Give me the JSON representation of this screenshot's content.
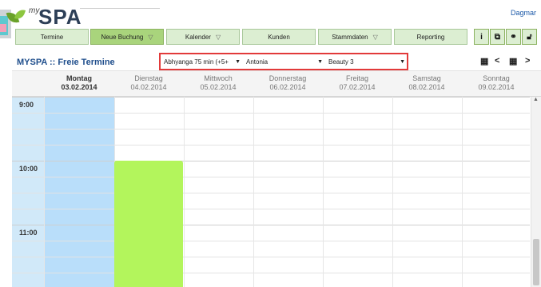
{
  "brand": {
    "prefix": "my",
    "name": "SPA"
  },
  "user": "Dagmar",
  "nav": [
    {
      "label": "Termine",
      "dropdown": false,
      "active": false
    },
    {
      "label": "Neue Buchung",
      "dropdown": true,
      "active": true
    },
    {
      "label": "Kalender",
      "dropdown": true,
      "active": false
    },
    {
      "label": "Kunden",
      "dropdown": false,
      "active": false
    },
    {
      "label": "Stammdaten",
      "dropdown": true,
      "active": false
    },
    {
      "label": "Reporting",
      "dropdown": false,
      "active": false
    }
  ],
  "toolbar_icons": [
    "info-icon",
    "copy-icon",
    "users-icon",
    "lock-icon"
  ],
  "page_title": "MYSPA :: Freie Termine",
  "filters": {
    "treatment": "Abhyanga 75 min (+5+",
    "staff": "Antonia",
    "room": "Beauty 3"
  },
  "days": [
    {
      "name": "Montag",
      "date": "03.02.2014",
      "today": true
    },
    {
      "name": "Dienstag",
      "date": "04.02.2014",
      "today": false
    },
    {
      "name": "Mittwoch",
      "date": "05.02.2014",
      "today": false
    },
    {
      "name": "Donnerstag",
      "date": "06.02.2014",
      "today": false
    },
    {
      "name": "Freitag",
      "date": "07.02.2014",
      "today": false
    },
    {
      "name": "Samstag",
      "date": "08.02.2014",
      "today": false
    },
    {
      "name": "Sonntag",
      "date": "09.02.2014",
      "today": false
    }
  ],
  "times": [
    "9:00",
    "10:00",
    "11:00"
  ],
  "colors": {
    "accent": "#1f4e8c",
    "nav_active": "#a9d47c",
    "today_column": "#b9defa",
    "free_slot": "#b3f55c",
    "highlight_box": "#e23a3a"
  }
}
